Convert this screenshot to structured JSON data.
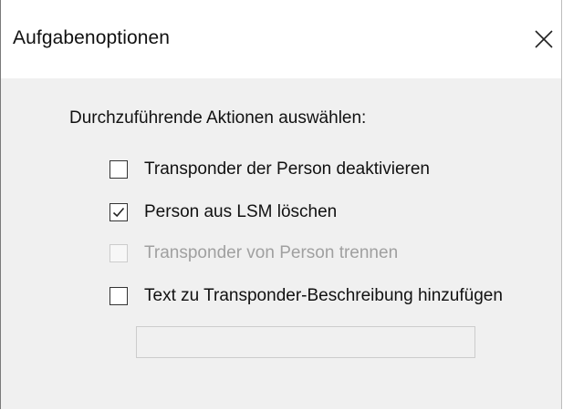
{
  "window": {
    "title": "Aufgabenoptionen",
    "close_icon": "close-icon"
  },
  "actions": {
    "heading": "Durchzuführende Aktionen auswählen:",
    "options": [
      {
        "label": "Transponder der Person deaktivieren",
        "checked": false,
        "enabled": true
      },
      {
        "label": "Person aus LSM löschen",
        "checked": true,
        "enabled": true
      },
      {
        "label": "Transponder von Person trennen",
        "checked": false,
        "enabled": false
      },
      {
        "label": "Text zu Transponder-Beschreibung hinzufügen",
        "checked": false,
        "enabled": true
      }
    ],
    "description_text": {
      "value": "",
      "enabled": false
    }
  },
  "colors": {
    "dialog_background": "#f0f0f0",
    "titlebar_background": "#ffffff",
    "text": "#111111",
    "disabled_text": "#a0a0a0"
  }
}
